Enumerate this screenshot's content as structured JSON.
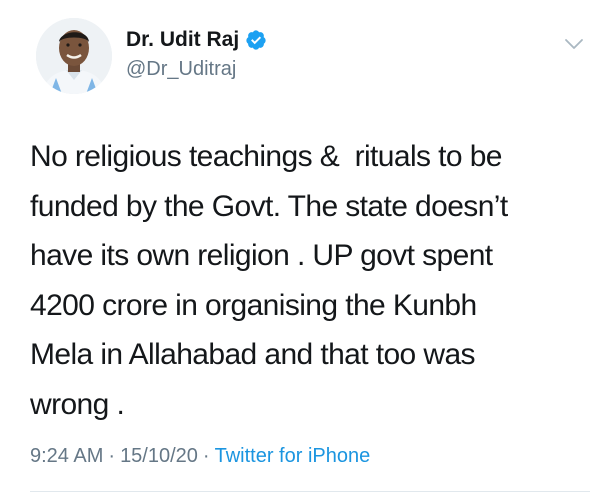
{
  "author": {
    "display_name": "Dr. Udit Raj",
    "handle": "@Dr_Uditraj",
    "verified": true
  },
  "tweet": {
    "lines": [
      "No religious teachings &  rituals to be",
      "funded by the Govt. The state doesn’t",
      "have its own religion . UP govt spent",
      "4200 crore in organising the Kunbh",
      "Mela in Allahabad and that too was",
      "wrong ."
    ]
  },
  "meta": {
    "time": "9:24 AM",
    "separator": "·",
    "date": "15/10/20",
    "source": "Twitter for iPhone"
  },
  "icons": {
    "verified": "verified-badge-icon",
    "menu": "chevron-down-icon"
  },
  "colors": {
    "text": "#14171a",
    "secondary": "#657786",
    "accent": "#1b95e0",
    "verified": "#1da1f2"
  }
}
